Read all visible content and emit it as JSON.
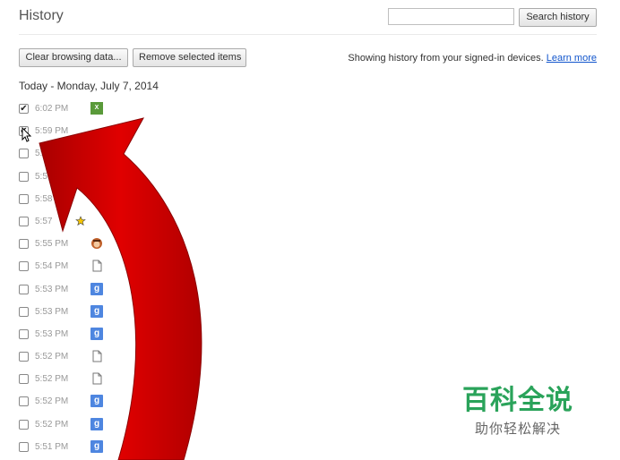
{
  "header": {
    "title": "History",
    "search_placeholder": "",
    "search_button": "Search history"
  },
  "toolbar": {
    "clear_label": "Clear browsing data...",
    "remove_label": "Remove selected items",
    "info_text": "Showing history from your signed-in devices.",
    "learn_more": "Learn more"
  },
  "history": {
    "date_heading": "Today - Monday, July 7, 2014",
    "items": [
      {
        "time": "6:02 PM",
        "icon": "spreadsheet-icon",
        "checked": true
      },
      {
        "time": "5:59 PM",
        "icon": "",
        "checked": true
      },
      {
        "time": "5:5",
        "icon": "",
        "checked": false
      },
      {
        "time": "5:5",
        "icon": "",
        "checked": false
      },
      {
        "time": "5:58",
        "icon": "",
        "checked": false
      },
      {
        "time": "5:57",
        "icon": "star-icon",
        "checked": false
      },
      {
        "time": "5:55 PM",
        "icon": "avatar-icon",
        "checked": false
      },
      {
        "time": "5:54 PM",
        "icon": "page-icon",
        "checked": false
      },
      {
        "time": "5:53 PM",
        "icon": "google-icon",
        "checked": false
      },
      {
        "time": "5:53 PM",
        "icon": "google-icon",
        "checked": false
      },
      {
        "time": "5:53 PM",
        "icon": "google-icon",
        "checked": false
      },
      {
        "time": "5:52 PM",
        "icon": "page-icon",
        "checked": false
      },
      {
        "time": "5:52 PM",
        "icon": "page-icon",
        "checked": false
      },
      {
        "time": "5:52 PM",
        "icon": "google-icon",
        "checked": false
      },
      {
        "time": "5:52 PM",
        "icon": "google-icon",
        "checked": false
      },
      {
        "time": "5:51 PM",
        "icon": "google-icon",
        "checked": false
      }
    ]
  },
  "watermark": {
    "title": "百科全说",
    "subtitle": "助你轻松解决"
  },
  "colors": {
    "arrow": "#d40000",
    "link": "#1155cc",
    "watermark_green": "#2aa35a"
  }
}
